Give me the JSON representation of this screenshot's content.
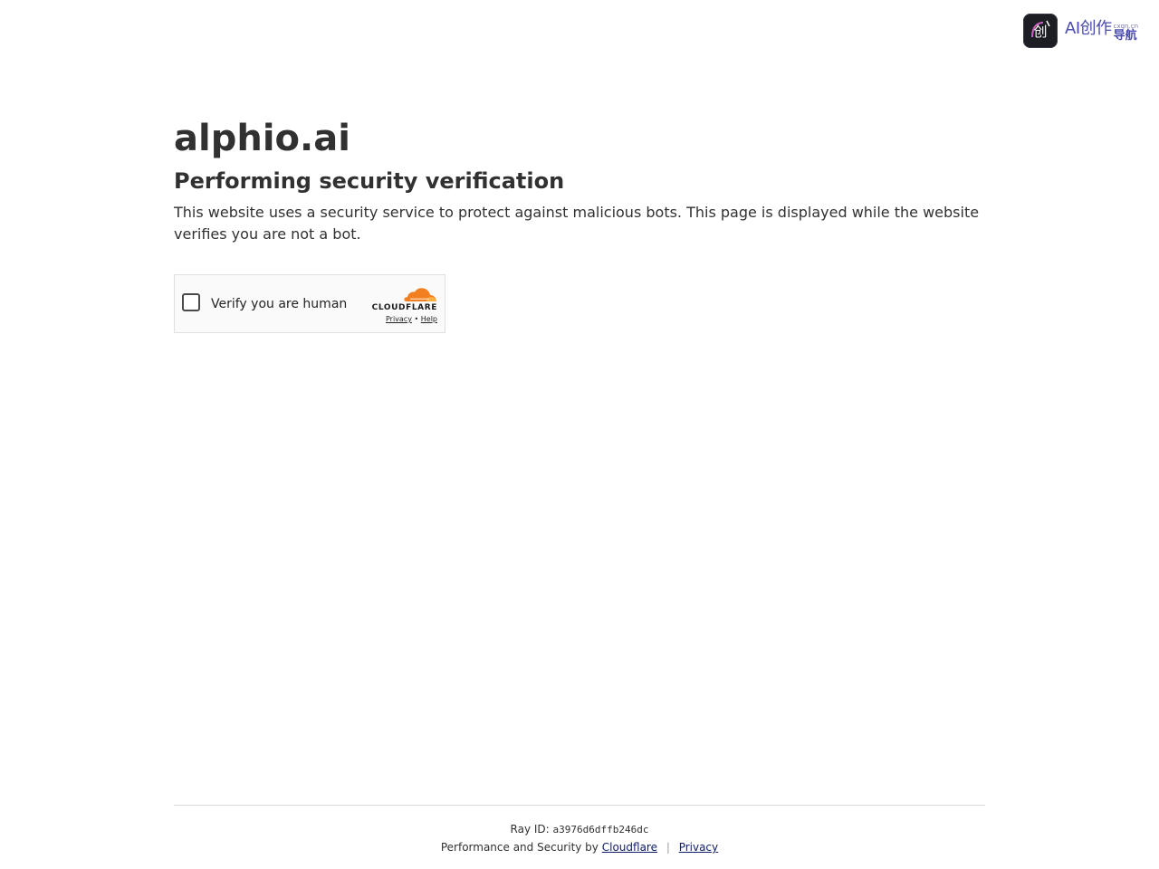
{
  "corner_logo": {
    "badge_char": "创",
    "brand_main": "AI创作",
    "brand_domain": "cxgn.cn",
    "brand_sub": "导航",
    "accent_color": "#4a4ab0",
    "badge_color": "#1d1d24"
  },
  "main": {
    "site_title": "alphio.ai",
    "heading": "Performing security verification",
    "description": "This website uses a security service to protect against malicious bots. This page is displayed while the website verifies you are not a bot."
  },
  "widget": {
    "checkbox_checked": false,
    "label": "Verify you are human",
    "brand_word": "CLOUDFLARE",
    "privacy_link": "Privacy",
    "separator": "•",
    "help_link": "Help",
    "cloud_color": "#f38020"
  },
  "footer": {
    "ray_label": "Ray ID:",
    "ray_id": "a3976d6dffb246dc",
    "perf_text": "Performance and Security by",
    "cloudflare_link": "Cloudflare",
    "separator": "|",
    "privacy_link": "Privacy"
  }
}
